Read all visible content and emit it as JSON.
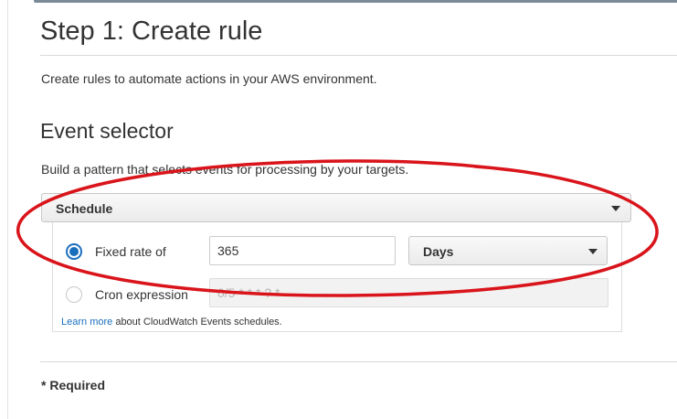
{
  "page": {
    "title": "Step 1: Create rule",
    "intro": "Create rules to automate actions in your AWS environment.",
    "required_note": "* Required"
  },
  "event_selector": {
    "title": "Event selector",
    "description": "Build a pattern that selects events for processing by your targets.",
    "source_dropdown": {
      "selected": "Schedule"
    },
    "options": {
      "fixed_rate": {
        "label": "Fixed rate of",
        "selected": true,
        "value": "365",
        "unit": "Days"
      },
      "cron": {
        "label": "Cron expression",
        "selected": false,
        "placeholder": "0/5 * * * ? *"
      }
    },
    "help": {
      "link_text": "Learn more",
      "text": " about CloudWatch Events schedules."
    }
  },
  "colors": {
    "accent": "#1a6fbd",
    "annotation": "#d9141b",
    "text": "#333333"
  }
}
